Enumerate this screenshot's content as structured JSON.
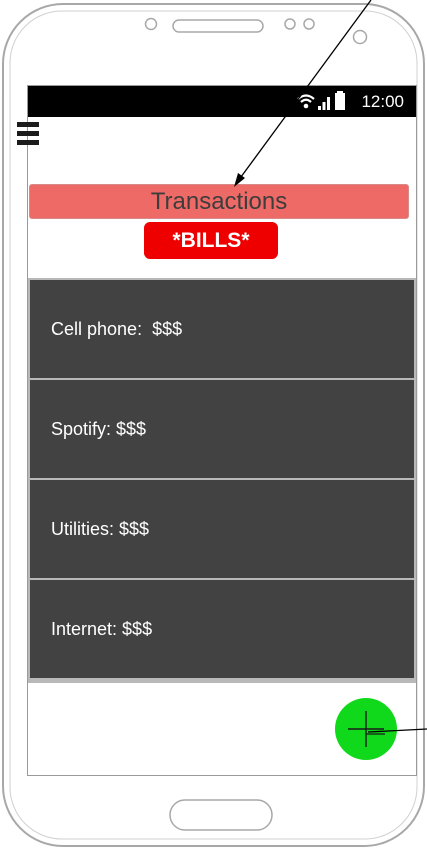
{
  "status_bar": {
    "time": "12:00",
    "icons": [
      "wifi-icon",
      "signal-icon",
      "battery-icon"
    ]
  },
  "header": {
    "menu_icon": "hamburger-menu-icon",
    "title": "Transactions",
    "badge": "*BILLS*"
  },
  "bills": [
    {
      "label": "Cell phone:  $$$"
    },
    {
      "label": "Spotify: $$$"
    },
    {
      "label": "Utilities: $$$"
    },
    {
      "label": "Internet: $$$"
    }
  ],
  "fab": {
    "icon": "plus-icon"
  },
  "colors": {
    "title_bar": "#ee6a66",
    "badge": "#ee0000",
    "list_item": "#424242",
    "fab": "#10d81a",
    "status_bar": "#000000"
  }
}
